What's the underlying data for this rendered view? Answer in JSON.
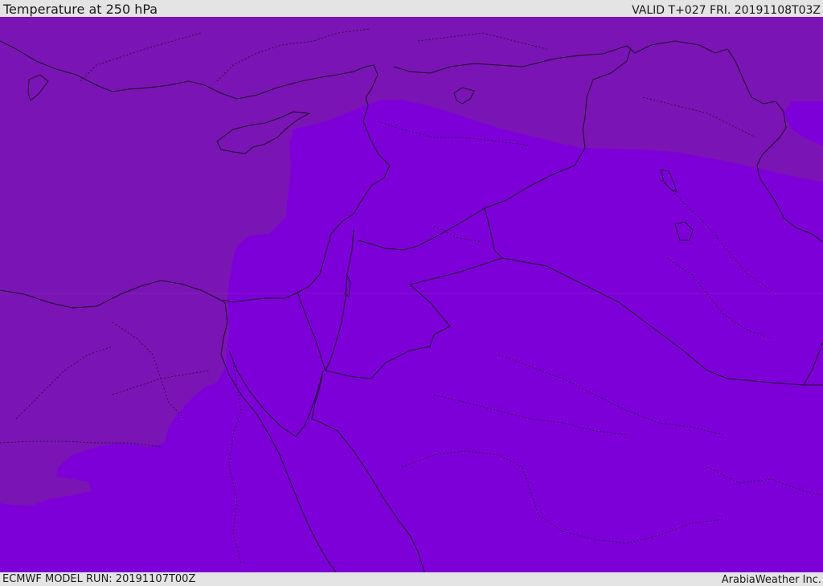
{
  "header": {
    "title": "Temperature at 250 hPa",
    "valid_time": "VALID T+027 FRI. 20191108T03Z"
  },
  "footer": {
    "model_run": "ECMWF MODEL RUN: 20191107T00Z",
    "credit": "ArabiaWeather Inc."
  },
  "map": {
    "field_colors": {
      "colder_region": "#7b14b4",
      "warmer_region": "#7e00d8"
    },
    "coastline_color": "#1a0a2a",
    "border_color": "#1a0a2a"
  }
}
